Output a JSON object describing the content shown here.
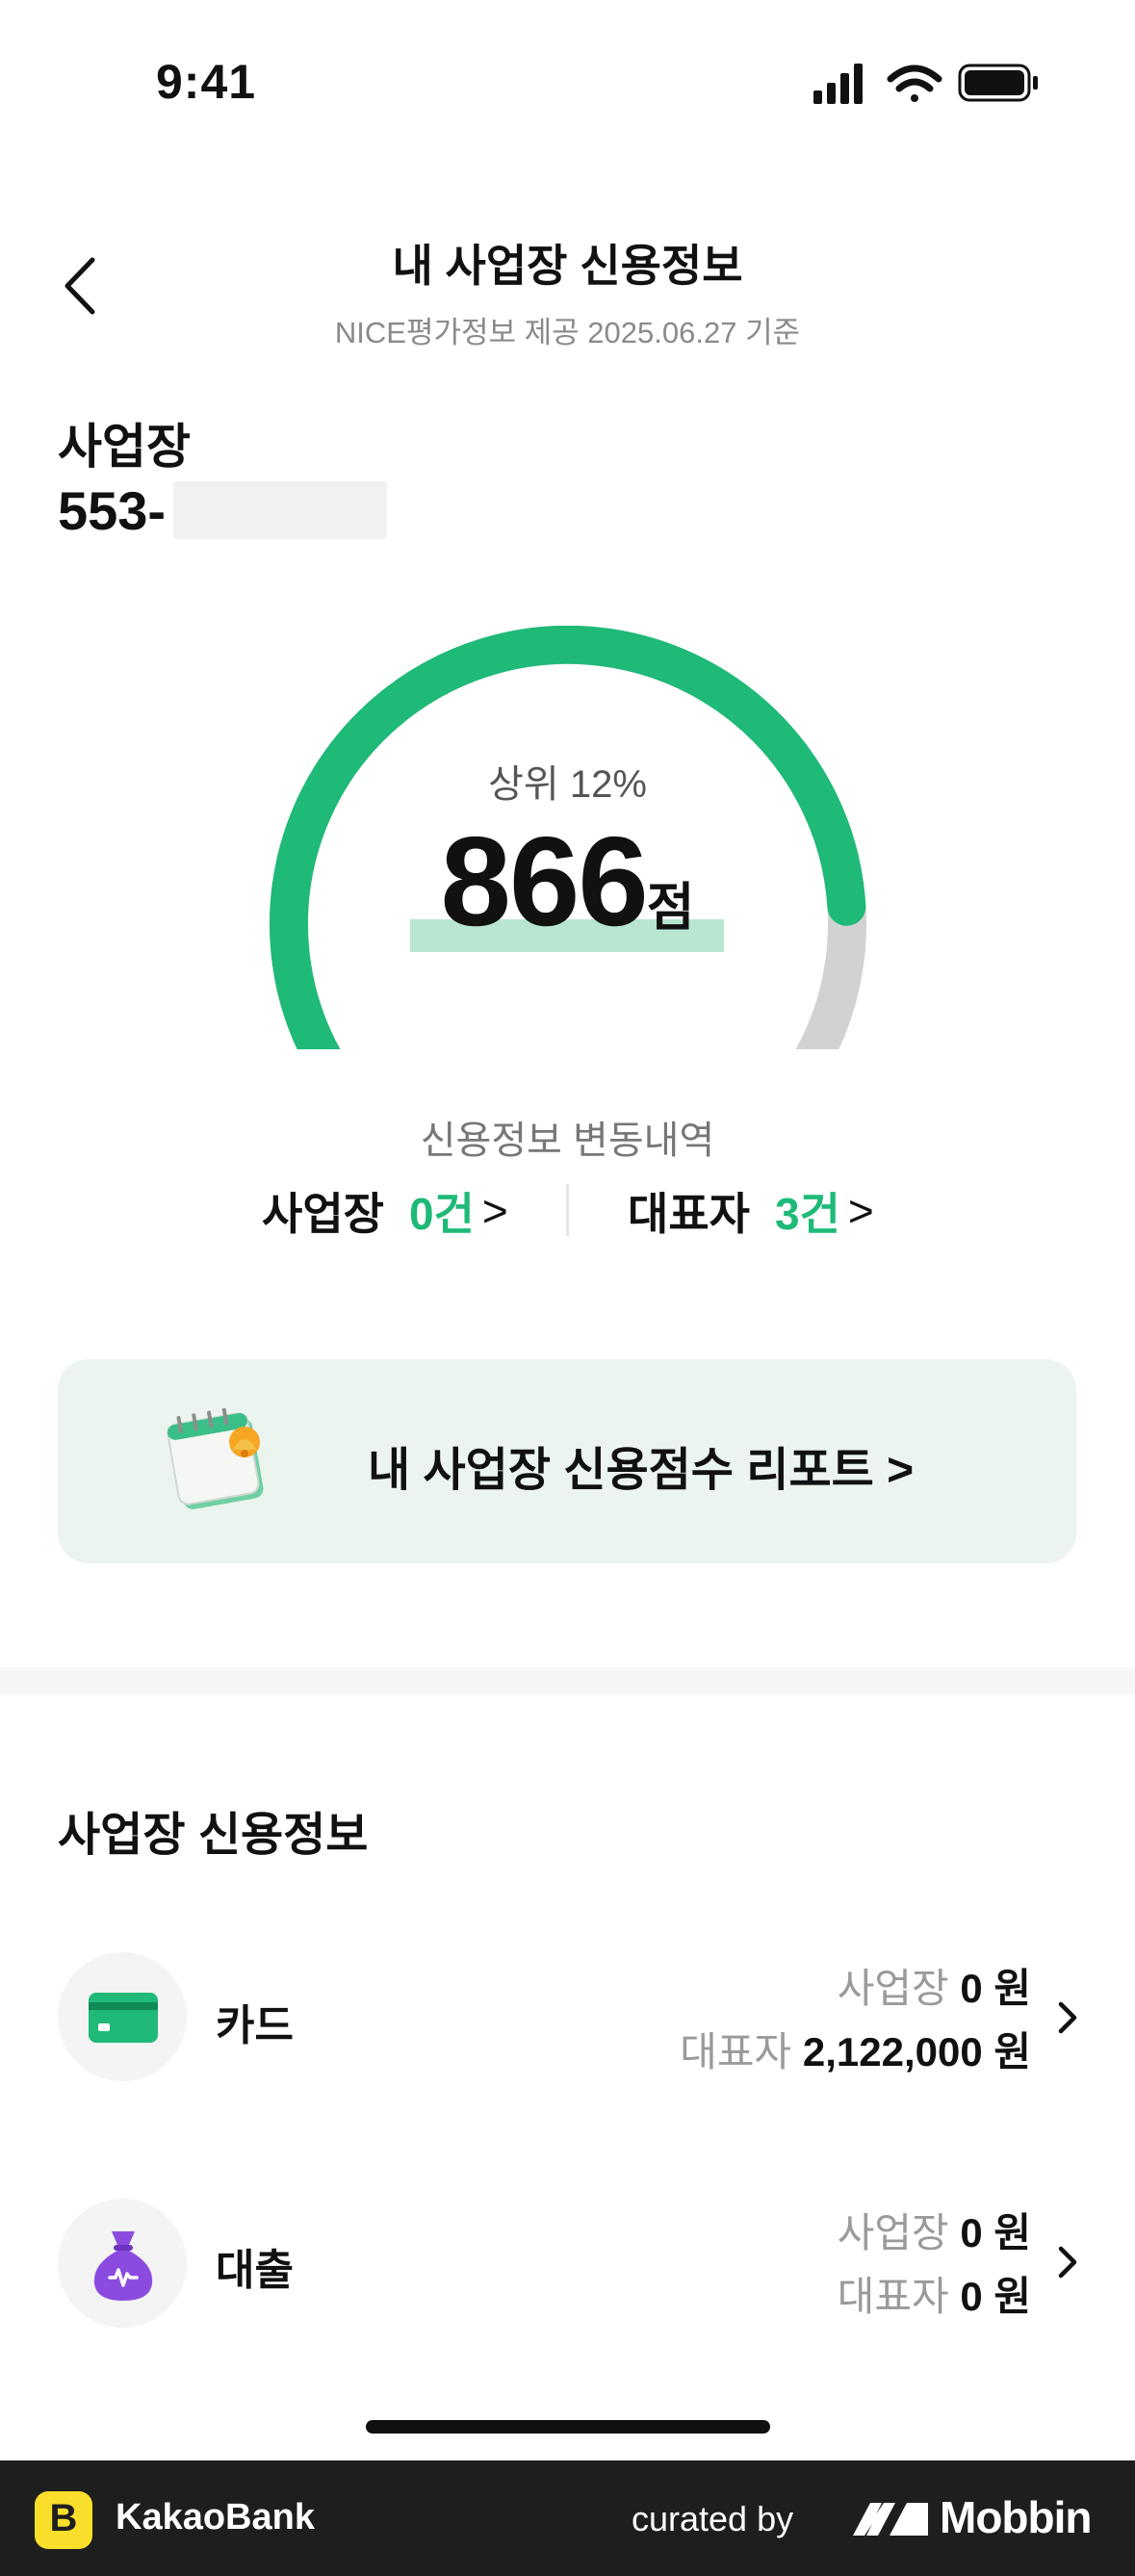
{
  "status_bar": {
    "time": "9:41"
  },
  "header": {
    "title": "내 사업장 신용정보",
    "subtitle": "NICE평가정보 제공 2025.06.27 기준"
  },
  "business": {
    "label": "사업장",
    "number": "553-"
  },
  "gauge": {
    "rank_text": "상위 12%",
    "score": "866",
    "score_unit": "점",
    "fill_fraction": 0.86
  },
  "changes": {
    "title": "신용정보 변동내역",
    "business_label": "사업장",
    "business_count": "0건",
    "representative_label": "대표자",
    "representative_count": "3건",
    "chevron": ">"
  },
  "report_banner": {
    "label": "내 사업장 신용점수 리포트 >"
  },
  "credit_section": {
    "title": "사업장 신용정보",
    "rows": [
      {
        "label": "카드",
        "business_key": "사업장",
        "business_value": "0 원",
        "rep_key": "대표자",
        "rep_value": "2,122,000 원"
      },
      {
        "label": "대출",
        "business_key": "사업장",
        "business_value": "0 원",
        "rep_key": "대표자",
        "rep_value": "0 원"
      }
    ]
  },
  "footer": {
    "app_name": "KakaoBank",
    "logo_letter": "B",
    "curated_by": "curated by",
    "mobbin": "Mobbin"
  },
  "colors": {
    "accent_green": "#1fb978",
    "gauge_track": "#d2d2d2",
    "banner_bg": "#ebf4ee",
    "loan_purple": "#8b4be0",
    "card_green": "#1fb978"
  }
}
